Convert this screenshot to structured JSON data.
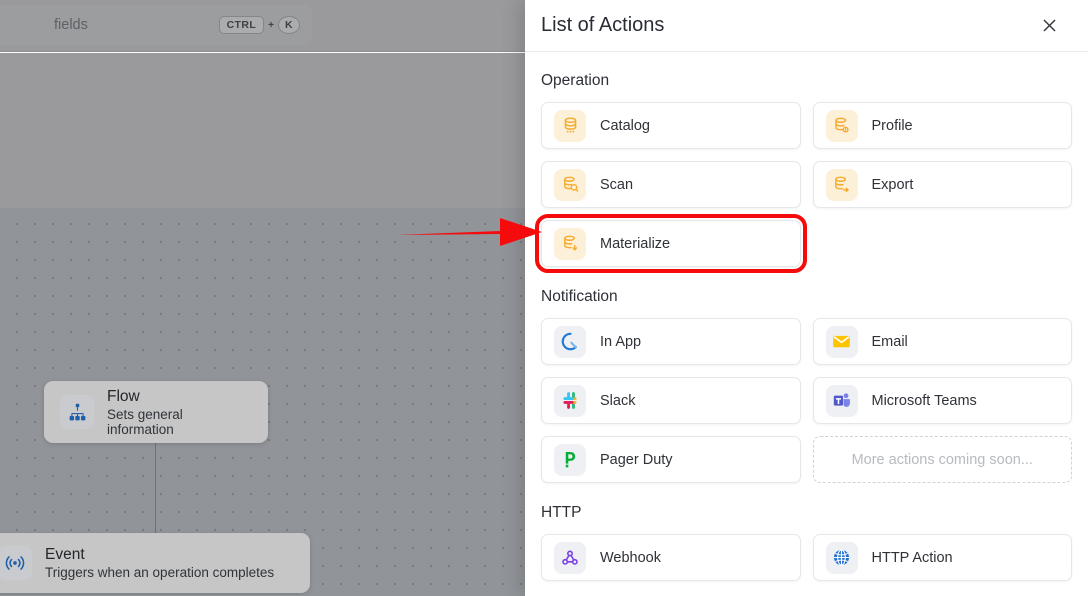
{
  "backdrop": {
    "search": {
      "visible_text": "fields",
      "shortcut": {
        "key1": "CTRL",
        "plus": "+",
        "key2": "K"
      }
    },
    "nodes": [
      {
        "icon": "sitemap-icon",
        "title": "Flow",
        "subtitle": "Sets general information"
      },
      {
        "icon": "broadcast-icon",
        "title": "Event",
        "subtitle": "Triggers when an operation completes"
      }
    ]
  },
  "drawer": {
    "title": "List of Actions",
    "close_icon": "close-icon",
    "sections": [
      {
        "id": "operation",
        "title": "Operation",
        "items": [
          {
            "label": "Catalog",
            "icon": "database-icon",
            "tile": "amber",
            "highlighted": false
          },
          {
            "label": "Profile",
            "icon": "database-profile-icon",
            "tile": "amber",
            "highlighted": false
          },
          {
            "label": "Scan",
            "icon": "database-search-icon",
            "tile": "amber",
            "highlighted": false
          },
          {
            "label": "Export",
            "icon": "database-export-icon",
            "tile": "amber",
            "highlighted": false
          },
          {
            "label": "Materialize",
            "icon": "database-materialize-icon",
            "tile": "amber",
            "highlighted": true
          }
        ]
      },
      {
        "id": "notification",
        "title": "Notification",
        "items": [
          {
            "label": "In App",
            "icon": "in-app-icon",
            "tile": "pale",
            "highlighted": false
          },
          {
            "label": "Email",
            "icon": "email-icon",
            "tile": "pale",
            "highlighted": false
          },
          {
            "label": "Slack",
            "icon": "slack-icon",
            "tile": "pale",
            "highlighted": false
          },
          {
            "label": "Microsoft Teams",
            "icon": "microsoft-teams-icon",
            "tile": "pale",
            "highlighted": false
          },
          {
            "label": "Pager Duty",
            "icon": "pager-duty-icon",
            "tile": "pale",
            "highlighted": false
          },
          {
            "label": "More actions coming soon...",
            "icon": "none",
            "tile": "none",
            "placeholder": true
          }
        ]
      },
      {
        "id": "http",
        "title": "HTTP",
        "items": [
          {
            "label": "Webhook",
            "icon": "webhook-icon",
            "tile": "pale",
            "highlighted": false
          },
          {
            "label": "HTTP Action",
            "icon": "globe-icon",
            "tile": "pale",
            "highlighted": false
          }
        ]
      }
    ]
  },
  "annotation": {
    "type": "arrow",
    "color": "#f50b0b",
    "points_to": "Materialize"
  },
  "colors": {
    "accent_amber": "#f5a623",
    "annotation_red": "#f50b0b",
    "node_icon_blue": "#1f5fa8",
    "overlay_gray": "#9a9a9c",
    "canvas_gray": "#919599"
  }
}
